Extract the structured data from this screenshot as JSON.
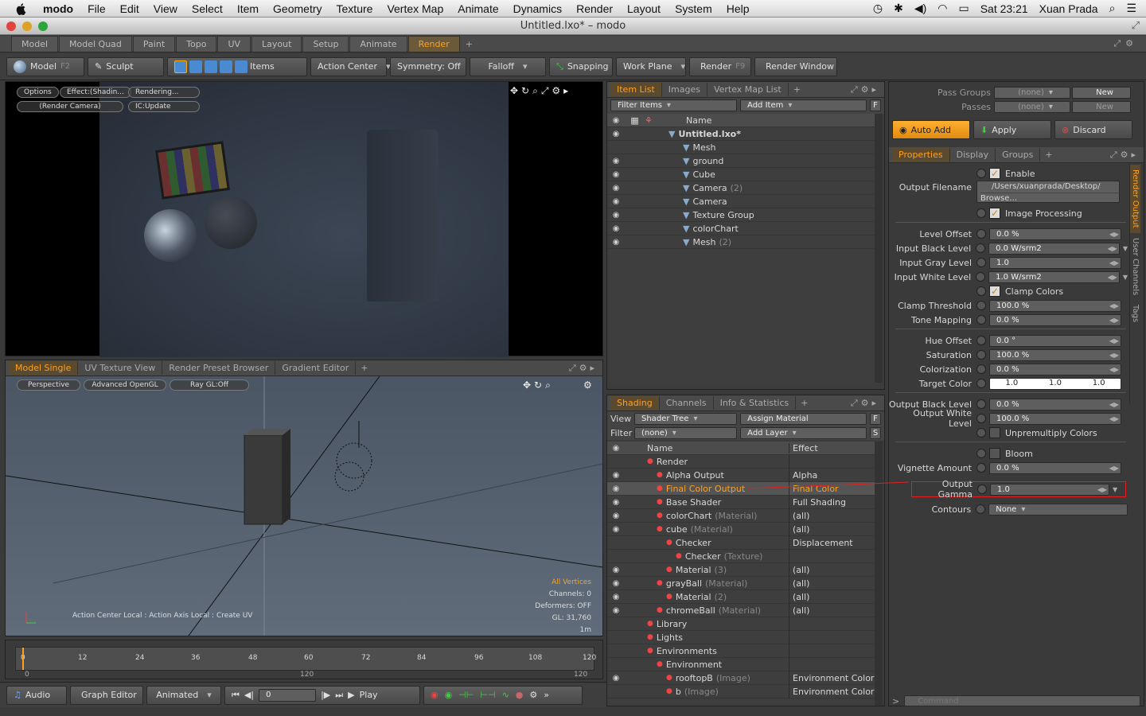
{
  "menubar": {
    "app": "modo",
    "items": [
      "File",
      "Edit",
      "View",
      "Select",
      "Item",
      "Geometry",
      "Texture",
      "Vertex Map",
      "Animate",
      "Dynamics",
      "Render",
      "Layout",
      "System",
      "Help"
    ],
    "clock": "Sat 23:21",
    "user": "Xuan Prada"
  },
  "window": {
    "title": "Untitled.lxo* – modo"
  },
  "layout_tabs": [
    "Model",
    "Model Quad",
    "Paint",
    "Topo",
    "UV",
    "Layout",
    "Setup",
    "Animate",
    "Render"
  ],
  "layout_tab_active": "Render",
  "toolbar": {
    "model": "Model",
    "model_key": "F2",
    "sculpt": "Sculpt",
    "items": "Items",
    "action_center": "Action Center",
    "symmetry": "Symmetry: Off",
    "falloff": "Falloff",
    "snapping": "Snapping",
    "work_plane": "Work Plane",
    "render": "Render",
    "render_key": "F9",
    "render_window": "Render Window"
  },
  "render_view": {
    "options": "Options",
    "effect": "Effect:(Shadin...",
    "rendering": "Rendering...",
    "camera": "(Render Camera)",
    "ic": "IC:Update"
  },
  "model_panel": {
    "tabs": [
      "Model Single",
      "UV Texture View",
      "Render Preset Browser",
      "Gradient Editor"
    ],
    "active": "Model Single",
    "perspective": "Perspective",
    "advanced": "Advanced OpenGL",
    "raygl": "Ray GL:Off",
    "info": [
      "All Vertices",
      "Channels: 0",
      "Deformers: OFF",
      "GL: 31,760",
      "1m"
    ],
    "status": "Action Center Local : Action Axis Local : Create UV"
  },
  "timeline": {
    "ticks": [
      "0",
      "12",
      "24",
      "36",
      "48",
      "60",
      "72",
      "84",
      "96",
      "108",
      "120"
    ],
    "sub": [
      "0",
      "120",
      "120"
    ]
  },
  "dock": {
    "audio": "Audio",
    "graph": "Graph Editor",
    "animated": "Animated",
    "frame": "0",
    "play": "Play"
  },
  "item_list": {
    "tabs": [
      "Item List",
      "Images",
      "Vertex Map List"
    ],
    "active": "Item List",
    "filter": "Filter Items",
    "add": "Add Item",
    "header": "Name",
    "rows": [
      {
        "name": "Untitled.lxo*",
        "extra": "",
        "bold": true,
        "indent": 0,
        "eye": true
      },
      {
        "name": "Mesh",
        "extra": "",
        "indent": 1,
        "eye": false
      },
      {
        "name": "ground",
        "extra": "",
        "indent": 1,
        "eye": true
      },
      {
        "name": "Cube",
        "extra": "",
        "indent": 1,
        "eye": true
      },
      {
        "name": "Camera",
        "extra": "(2)",
        "indent": 1,
        "eye": true
      },
      {
        "name": "Camera",
        "extra": "",
        "indent": 1,
        "eye": true
      },
      {
        "name": "Texture Group",
        "extra": "",
        "indent": 1,
        "eye": true
      },
      {
        "name": "colorChart",
        "extra": "",
        "indent": 1,
        "eye": true
      },
      {
        "name": "Mesh",
        "extra": "(2)",
        "indent": 1,
        "eye": true
      }
    ]
  },
  "shading": {
    "tabs": [
      "Shading",
      "Channels",
      "Info & Statistics"
    ],
    "active": "Shading",
    "view_label": "View",
    "view": "Shader Tree",
    "assign": "Assign Material",
    "filter_label": "Filter",
    "filter": "(none)",
    "add_layer": "Add Layer",
    "col_name": "Name",
    "col_effect": "Effect",
    "rows": [
      {
        "name": "Render",
        "extra": "",
        "effect": "",
        "indent": 0,
        "eye": false
      },
      {
        "name": "Alpha Output",
        "extra": "",
        "effect": "Alpha",
        "indent": 1,
        "eye": true
      },
      {
        "name": "Final Color Output",
        "extra": "",
        "effect": "Final Color",
        "indent": 1,
        "eye": true,
        "sel": true
      },
      {
        "name": "Base Shader",
        "extra": "",
        "effect": "Full Shading",
        "indent": 1,
        "eye": true
      },
      {
        "name": "colorChart",
        "extra": "(Material)",
        "effect": "(all)",
        "indent": 1,
        "eye": true
      },
      {
        "name": "cube",
        "extra": "(Material)",
        "effect": "(all)",
        "indent": 1,
        "eye": true
      },
      {
        "name": "Checker",
        "extra": "",
        "effect": "Displacement",
        "indent": 2,
        "eye": false
      },
      {
        "name": "Checker",
        "extra": "(Texture)",
        "effect": "",
        "indent": 3,
        "eye": false
      },
      {
        "name": "Material",
        "extra": "(3)",
        "effect": "(all)",
        "indent": 2,
        "eye": true
      },
      {
        "name": "grayBall",
        "extra": "(Material)",
        "effect": "(all)",
        "indent": 1,
        "eye": true
      },
      {
        "name": "Material",
        "extra": "(2)",
        "effect": "(all)",
        "indent": 2,
        "eye": true
      },
      {
        "name": "chromeBall",
        "extra": "(Material)",
        "effect": "(all)",
        "indent": 1,
        "eye": true
      },
      {
        "name": "Library",
        "extra": "",
        "effect": "",
        "indent": 0,
        "eye": false
      },
      {
        "name": "Lights",
        "extra": "",
        "effect": "",
        "indent": 0,
        "eye": false
      },
      {
        "name": "Environments",
        "extra": "",
        "effect": "",
        "indent": 0,
        "eye": false
      },
      {
        "name": "Environment",
        "extra": "",
        "effect": "",
        "indent": 1,
        "eye": false
      },
      {
        "name": "rooftopB",
        "extra": "(Image)",
        "effect": "Environment Color",
        "indent": 2,
        "eye": true
      },
      {
        "name": "b",
        "extra": "(Image)",
        "effect": "Environment Color",
        "indent": 2,
        "eye": false
      }
    ]
  },
  "passes": {
    "groups_label": "Pass Groups",
    "groups_value": "(none)",
    "passes_label": "Passes",
    "passes_value": "(none)",
    "new": "New"
  },
  "actions": {
    "auto_add": "Auto Add",
    "apply": "Apply",
    "discard": "Discard"
  },
  "props_tabs": [
    "Properties",
    "Display",
    "Groups"
  ],
  "props_active": "Properties",
  "side_tabs": [
    "Render Output",
    "User Channels",
    "Tags"
  ],
  "properties": {
    "enable": "Enable",
    "output_filename_label": "Output Filename",
    "output_filename": "/Users/xuanprada/Desktop/",
    "browse": "Browse...",
    "image_processing": "Image Processing",
    "fields": [
      {
        "label": "Level Offset",
        "value": "0.0 %"
      },
      {
        "label": "Input Black Level",
        "value": "0.0 W/srm2",
        "dd": true
      },
      {
        "label": "Input Gray Level",
        "value": "1.0"
      },
      {
        "label": "Input White Level",
        "value": "1.0 W/srm2",
        "dd": true
      }
    ],
    "clamp": "Clamp Colors",
    "fields2": [
      {
        "label": "Clamp Threshold",
        "value": "100.0 %"
      },
      {
        "label": "Tone Mapping",
        "value": "0.0 %"
      }
    ],
    "fields3": [
      {
        "label": "Hue Offset",
        "value": "0.0 °"
      },
      {
        "label": "Saturation",
        "value": "100.0 %"
      },
      {
        "label": "Colorization",
        "value": "0.0 %"
      }
    ],
    "target_label": "Target Color",
    "target": [
      "1.0",
      "1.0",
      "1.0"
    ],
    "fields4": [
      {
        "label": "Output Black Level",
        "value": "0.0 %"
      },
      {
        "label": "Output White Level",
        "value": "100.0 %"
      }
    ],
    "unpremult": "Unpremultiply Colors",
    "bloom": "Bloom",
    "vignette_label": "Vignette Amount",
    "vignette": "0.0 %",
    "gamma_label": "Output Gamma",
    "gamma": "1.0",
    "contours_label": "Contours",
    "contours": "None"
  },
  "command": {
    "placeholder": "Command"
  }
}
